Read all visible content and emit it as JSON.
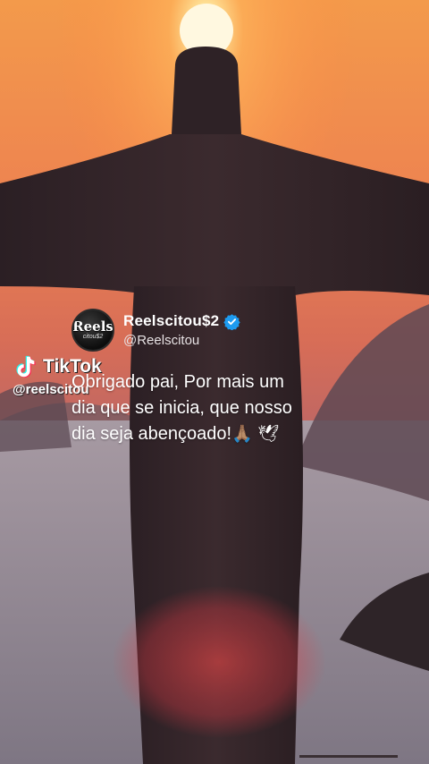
{
  "post": {
    "display_name": "Reelscitou$2",
    "handle": "@Reelscitou",
    "verified": true,
    "verified_color": "#1d9bf0",
    "text": "Obrigado pai, Por mais um\ndia que se inicia, que nosso\ndia seja abençoado!",
    "emojis": [
      "folded-hands",
      "dove"
    ],
    "avatar": {
      "top": "Reels",
      "bottom": "citou$2"
    }
  },
  "watermark": {
    "brand": "TikTok",
    "username": "@reelscitou"
  },
  "scene": {
    "subject": "christ-the-redeemer-statue-sunrise",
    "sky_colors": [
      "#f4a552",
      "#ea7d4f",
      "#c86356"
    ],
    "water_color": "#9c8b97"
  }
}
